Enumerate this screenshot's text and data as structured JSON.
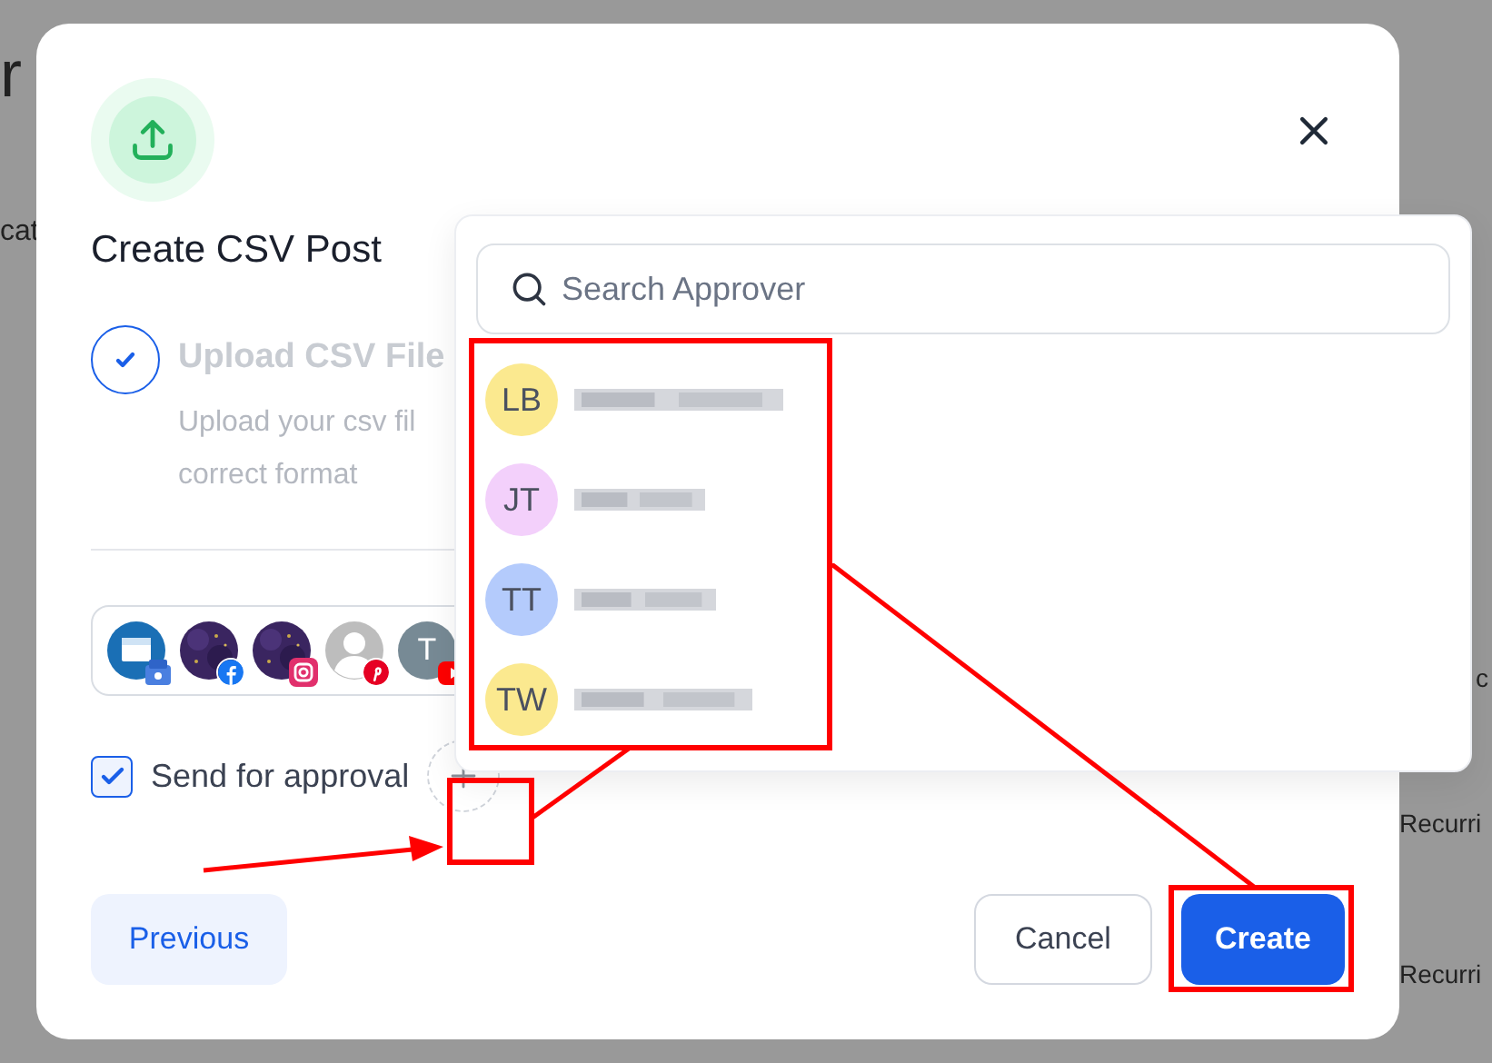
{
  "background_fragments": [
    {
      "text": "r"
    },
    {
      "text": "cat"
    },
    {
      "text": "c"
    },
    {
      "text": "Recurri"
    },
    {
      "text": "Recurri"
    }
  ],
  "dialog": {
    "title": "Create CSV Post",
    "step": {
      "title": "Upload CSV File",
      "description_lines": [
        "Upload your csv fil",
        "correct format"
      ],
      "completed": true
    },
    "accounts": [
      {
        "kind": "store_google"
      },
      {
        "kind": "photo_facebook"
      },
      {
        "kind": "photo_instagram"
      },
      {
        "kind": "person_pinterest"
      },
      {
        "kind": "letter_youtube",
        "initial": "T"
      }
    ],
    "approval": {
      "label": "Send for approval",
      "checked": true
    },
    "buttons": [
      {
        "label": "Previous",
        "kind": "secondary"
      },
      {
        "label": "Cancel",
        "kind": "outline"
      },
      {
        "label": "Create",
        "kind": "primary"
      }
    ]
  },
  "approver_menu": {
    "search": {
      "placeholder": "Search Approver"
    },
    "approvers": [
      {
        "initials": "LB",
        "color": "#fbe98f",
        "name_redacted": true
      },
      {
        "initials": "JT",
        "color": "#f3d0fb",
        "name_redacted": true
      },
      {
        "initials": "TT",
        "color": "#b4cbfc",
        "name_redacted": true
      },
      {
        "initials": "TW",
        "color": "#fbe98f",
        "name_redacted": true
      }
    ]
  }
}
